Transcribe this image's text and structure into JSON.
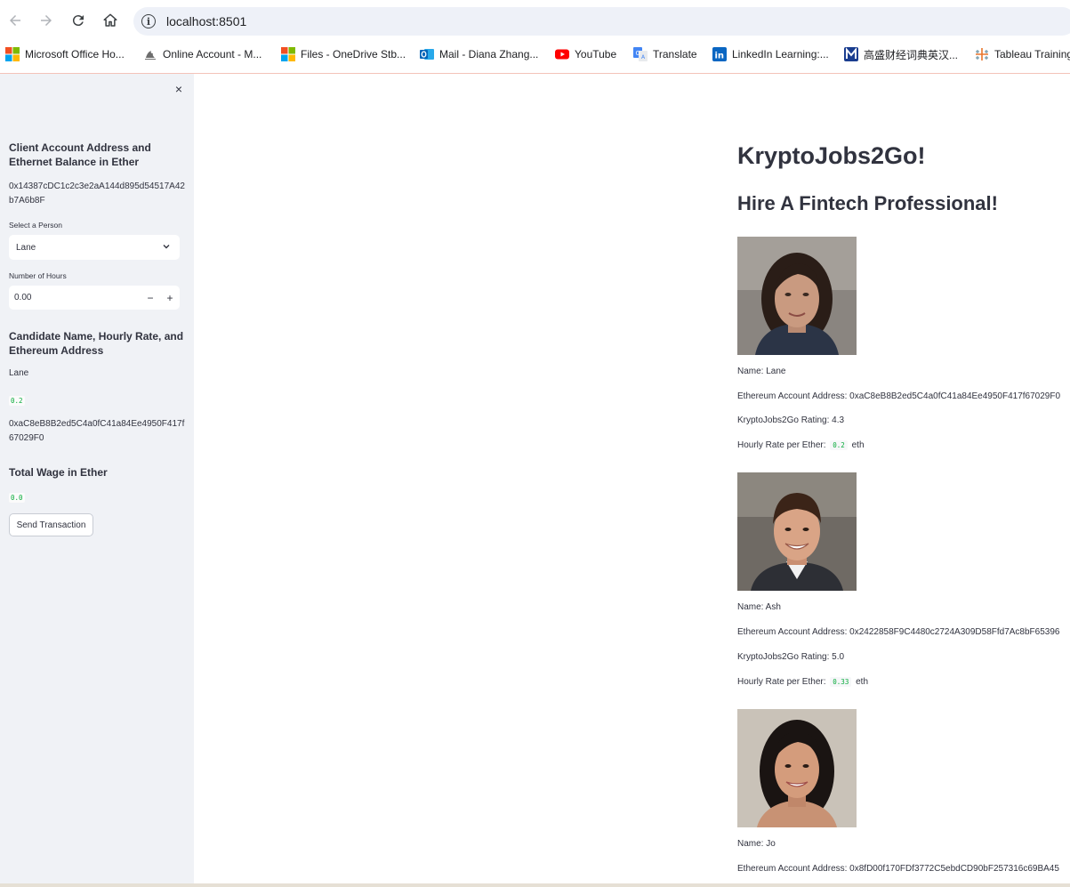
{
  "browser": {
    "url": "localhost:8501",
    "bookmarks": [
      {
        "label": "Microsoft Office Ho...",
        "icon": "microsoft-icon"
      },
      {
        "label": "Online Account - M...",
        "icon": "government-icon"
      },
      {
        "label": "Files - OneDrive Stb...",
        "icon": "microsoft-icon"
      },
      {
        "label": "Mail - Diana Zhang...",
        "icon": "outlook-icon"
      },
      {
        "label": "YouTube",
        "icon": "youtube-icon"
      },
      {
        "label": "Translate",
        "icon": "translate-icon"
      },
      {
        "label": "LinkedIn Learning:...",
        "icon": "linkedin-icon"
      },
      {
        "label": "高盛财经词典英汉...",
        "icon": "dictionary-icon"
      },
      {
        "label": "Tableau Training",
        "icon": "tableau-icon"
      }
    ]
  },
  "sidebar": {
    "close_icon": "×",
    "account_heading": "Client Account Address and Ethernet Balance in Ether",
    "account_address": "0x14387cDC1c2c3e2aA144d895d54517A42b7A6b8F",
    "select_label": "Select a Person",
    "select_value": "Lane",
    "hours_label": "Number of Hours",
    "hours_value": "0.00",
    "hours_minus": "−",
    "hours_plus": "+",
    "candidate_heading": "Candidate Name, Hourly Rate, and Ethereum Address",
    "candidate_name": "Lane",
    "candidate_rate": "0.2",
    "candidate_address": "0xaC8eB8B2ed5C4a0fC41a84Ee4950F417f67029F0",
    "wage_heading": "Total Wage in Ether",
    "wage_value": "0.0",
    "send_button": "Send Transaction"
  },
  "main": {
    "title": "KryptoJobs2Go!",
    "subtitle": "Hire A Fintech Professional!",
    "candidates": [
      {
        "name": "Name: Lane",
        "address": "Ethereum Account Address: 0xaC8eB8B2ed5C4a0fC41a84Ee4950F417f67029F0",
        "rating": "KryptoJobs2Go Rating: 4.3",
        "rate_prefix": "Hourly Rate per Ether:",
        "rate": "0.2",
        "rate_unit": "eth"
      },
      {
        "name": "Name: Ash",
        "address": "Ethereum Account Address: 0x2422858F9C4480c2724A309D58Ffd7Ac8bF65396",
        "rating": "KryptoJobs2Go Rating: 5.0",
        "rate_prefix": "Hourly Rate per Ether:",
        "rate": "0.33",
        "rate_unit": "eth"
      },
      {
        "name": "Name: Jo",
        "address": "Ethereum Account Address: 0x8fD00f170FDf3772C5ebdCD90bF257316c69BA45"
      }
    ]
  },
  "colors": {
    "sidebar_bg": "#f0f2f6",
    "code_green": "#09ab3b",
    "text": "#31333f",
    "address_bar": "#eef1f8"
  }
}
